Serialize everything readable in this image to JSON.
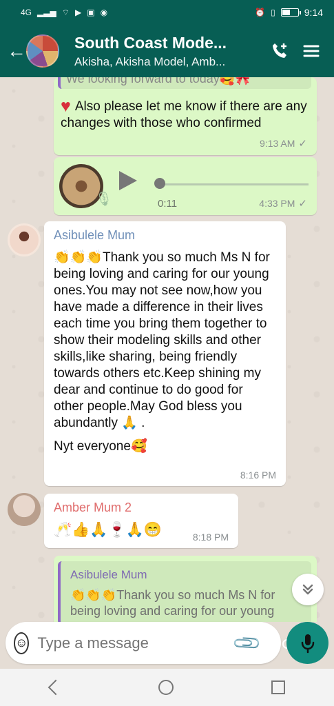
{
  "status": {
    "network": "4G",
    "time": "9:14",
    "battery_level": 0.45
  },
  "header": {
    "title": "South Coast Mode...",
    "subtitle": "Akisha, Akisha Model, Amb..."
  },
  "icons": {
    "back": "arrow-left-icon",
    "call": "add-call-icon",
    "menu": "hamburger-menu-icon",
    "emoji": "emoji-icon",
    "attach": "paperclip-icon",
    "camera": "camera-icon",
    "mic": "mic-icon"
  },
  "messages": {
    "quoted_cutoff": "We looking forward to today🥰🎀",
    "first": {
      "text": "Also please let me know if there are any changes with those who confirmed",
      "time": "9:13 AM",
      "check": "✓"
    },
    "audio": {
      "duration": "0:11",
      "time": "4:33 PM",
      "check": "✓"
    },
    "asibulele": {
      "sender": "Asibulele Mum",
      "text": "👏👏👏Thank you so much Ms N for being loving and caring for our young ones.You may not see now,how you have made a difference in their lives each time you bring them together to show their modeling skills and other skills,like sharing, being friendly towards others etc.Keep shining my dear and continue to do good for other people.May God bless you abundantly 🙏 .",
      "second_line": "Nyt everyone🥰",
      "time": "8:16 PM"
    },
    "amber": {
      "sender": "Amber Mum 2",
      "text": "🥂👍🙏🍷🙏😁",
      "time": "8:18 PM"
    },
    "reply": {
      "sender": "Asibulele Mum",
      "text": "👏👏👏Thank you so much Ms N for being loving and caring for our young ones"
    }
  },
  "composer": {
    "placeholder": "Type a message"
  }
}
